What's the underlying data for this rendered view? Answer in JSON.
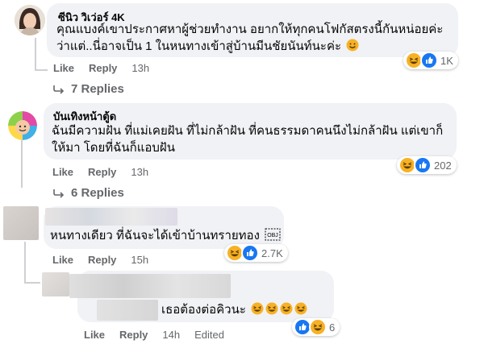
{
  "comments": [
    {
      "author": "ซีนิว วิเว่อร์ 4K",
      "text_lines": [
        "คุณแบงค์เขาประกาศหาผู้ช่วยทำงาน อยากให้ทุกคนโฟกัสตรงนี้กันหน่อยค่ะ",
        "ว่าแต่..นี่อาจเป็น 1 ในหนทางเข้าสู่บ้านมีนชัยนันท์นะค่ะ"
      ],
      "inline_emoji": "smiling-face-icon",
      "like": "Like",
      "reply": "Reply",
      "time": "13h",
      "reaction_count": "1K",
      "reactions": [
        "haha",
        "like"
      ],
      "view_replies": "7 Replies"
    },
    {
      "author": "บันเทิงหน้าตู้ด",
      "text_lines": [
        "ฉันมีความฝัน ที่แม่เคยฝัน ที่ไม่กล้าฝัน ที่คนธรรมดาคนนึงไม่กล้าฝัน แต่เขาก็",
        "ให้มา โดยที่ฉันก็แอบฝัน"
      ],
      "like": "Like",
      "reply": "Reply",
      "time": "13h",
      "reaction_count": "202",
      "reactions": [
        "haha",
        "like"
      ],
      "view_replies": "6 Replies"
    },
    {
      "author": "",
      "text_lines": [
        "หนทางเดียว ที่ฉันจะได้เข้าบ้านทรายทอง"
      ],
      "inline_emoji": "obj-glyph-icon",
      "like": "Like",
      "reply": "Reply",
      "time": "15h",
      "reaction_count": "2.7K",
      "reactions": [
        "haha",
        "like"
      ]
    },
    {
      "author": "",
      "text_lines": [
        "เธอต้องต่อคิวนะ"
      ],
      "inline_emojis": [
        "haha",
        "haha",
        "haha",
        "haha"
      ],
      "like": "Like",
      "reply": "Reply",
      "time": "14h",
      "edited": "Edited",
      "reaction_count": "6",
      "reactions": [
        "like",
        "haha"
      ]
    }
  ],
  "colors": {
    "bubble": "#f0f2f5",
    "text": "#050505",
    "secondary": "#65676b",
    "like_blue": "#1877f2",
    "haha_yellow": "#f7b125"
  }
}
